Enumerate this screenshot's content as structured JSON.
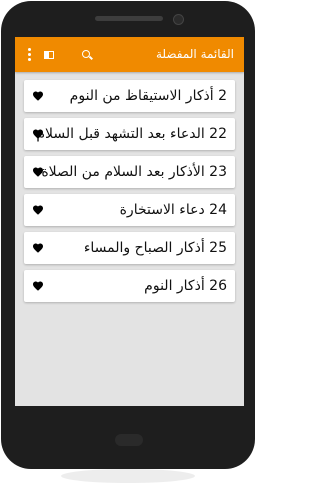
{
  "appbar": {
    "title": "القائمة المفضلة",
    "color": "#f08a00",
    "icons": [
      "overflow-menu-icon",
      "book-icon",
      "search-icon"
    ]
  },
  "favorites": [
    {
      "text": "2 أذكار الاستيقاظ من النوم"
    },
    {
      "text": "22 الدعاء بعد التشهد قبل السلام"
    },
    {
      "text": "23 الأذكار بعد السلام من الصلاة"
    },
    {
      "text": "24 دعاء الاستخارة"
    },
    {
      "text": "25 أذكار الصباح والمساء"
    },
    {
      "text": "26 أذكار النوم"
    }
  ],
  "item_icon": "heart-icon"
}
